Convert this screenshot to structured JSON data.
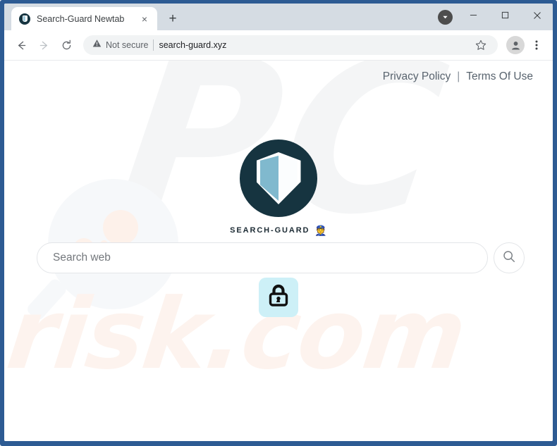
{
  "browser": {
    "tab": {
      "title": "Search-Guard Newtab",
      "favicon_name": "search-guard-favicon",
      "close_label": "×"
    },
    "new_tab_label": "+",
    "window_controls": {
      "minimize_label": "─",
      "maximize_label": "□",
      "close_label": "✕"
    },
    "extension_chevron_name": "extensions-chevron-icon",
    "toolbar": {
      "back_label": "←",
      "forward_label": "→",
      "reload_label": "⟳",
      "security_status": "Not secure",
      "security_icon_name": "warning-triangle-icon",
      "url": "search-guard.xyz",
      "bookmark_icon_name": "star-icon",
      "profile_icon_name": "profile-avatar-icon",
      "menu_icon_name": "three-dot-menu-icon"
    }
  },
  "page": {
    "header_links": {
      "privacy_policy": "Privacy Policy",
      "separator": "|",
      "terms_of_use": "Terms Of Use"
    },
    "brand": {
      "name": "SEARCH-GUARD",
      "cap_icon": "👮",
      "logo_circle_color": "#163440",
      "shield_left_color": "#80b9ce",
      "shield_right_color": "#fbfdfe"
    },
    "search": {
      "placeholder": "Search web",
      "value": "",
      "submit_icon_name": "search-icon"
    },
    "lock_tile": {
      "icon_name": "padlock-icon",
      "background_color": "#cdf0f7"
    },
    "watermarks": {
      "pc_letters": "PC",
      "risk_text": "risk.com",
      "magnifier_name": "magnifier-watermark"
    }
  }
}
